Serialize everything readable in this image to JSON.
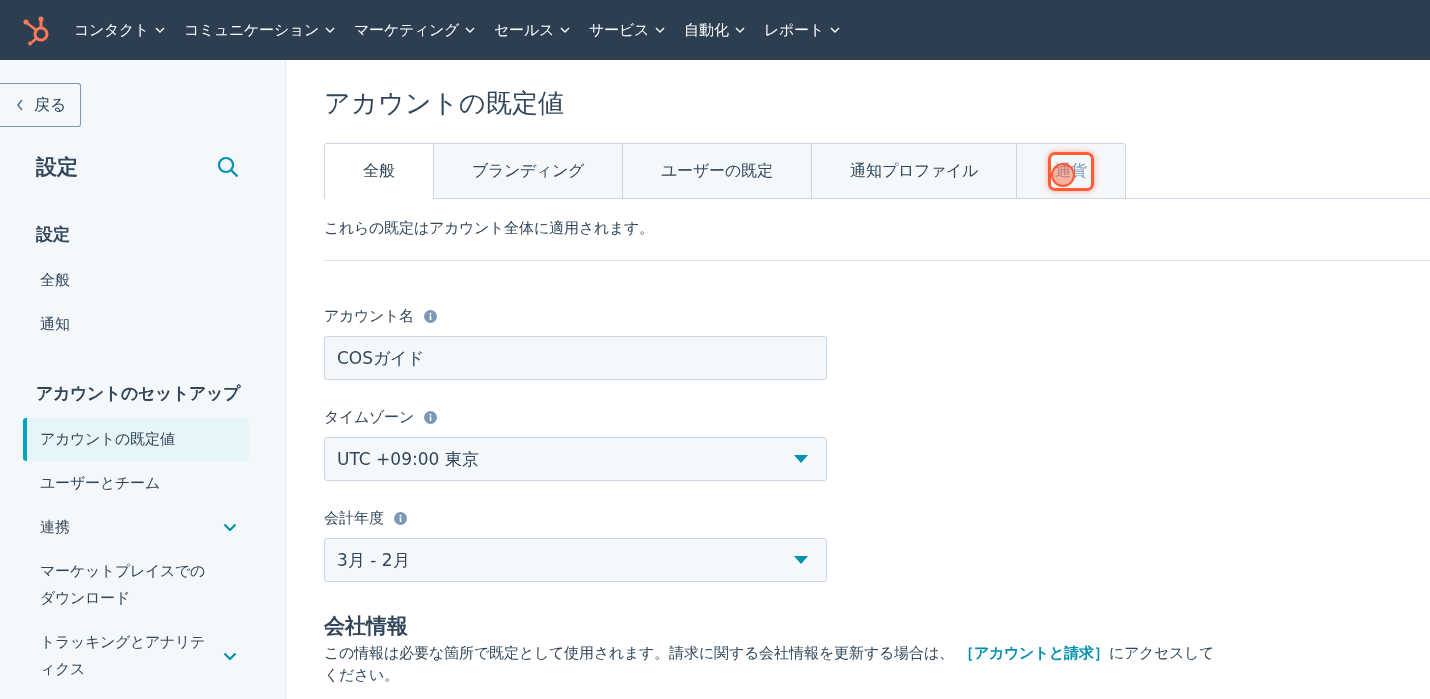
{
  "top_nav": {
    "items": [
      {
        "label": "コンタクト"
      },
      {
        "label": "コミュニケーション"
      },
      {
        "label": "マーケティング"
      },
      {
        "label": "セールス"
      },
      {
        "label": "サービス"
      },
      {
        "label": "自動化"
      },
      {
        "label": "レポート"
      }
    ]
  },
  "sidebar": {
    "back_button": "戻る",
    "title": "設定",
    "sections": [
      {
        "heading": "設定",
        "items": [
          {
            "label": "全般",
            "selected": false,
            "expandable": false
          },
          {
            "label": "通知",
            "selected": false,
            "expandable": false
          }
        ]
      },
      {
        "heading": "アカウントのセットアップ",
        "items": [
          {
            "label": "アカウントの既定値",
            "selected": true,
            "expandable": false
          },
          {
            "label": "ユーザーとチーム",
            "selected": false,
            "expandable": false
          },
          {
            "label": "連携",
            "selected": false,
            "expandable": true
          },
          {
            "label": "マーケットプレイスでのダウンロード",
            "selected": false,
            "expandable": false
          },
          {
            "label": "トラッキングとアナリティクス",
            "selected": false,
            "expandable": true
          }
        ]
      }
    ]
  },
  "page": {
    "title": "アカウントの既定値",
    "tabs": [
      {
        "label": "全般",
        "selected": true,
        "highlighted": false
      },
      {
        "label": "ブランディング",
        "selected": false,
        "highlighted": false
      },
      {
        "label": "ユーザーの既定",
        "selected": false,
        "highlighted": false
      },
      {
        "label": "通知プロファイル",
        "selected": false,
        "highlighted": false
      },
      {
        "label": "通貨",
        "selected": false,
        "highlighted": true
      }
    ],
    "description": "これらの既定はアカウント全体に適用されます。",
    "fields": [
      {
        "kind": "text",
        "label": "アカウント名",
        "value": "COSガイド"
      },
      {
        "kind": "select",
        "label": "タイムゾーン",
        "value": "UTC +09:00 東京"
      },
      {
        "kind": "select",
        "label": "会計年度",
        "value": "3月 - 2月"
      }
    ],
    "company_info": {
      "heading": "会社情報",
      "text": "この情報は必要な箇所で既定として使用されます。請求に関する会社情報を更新する場合は、",
      "link": "［アカウントと請求］",
      "text_after": "にアクセスしてください。"
    }
  }
}
